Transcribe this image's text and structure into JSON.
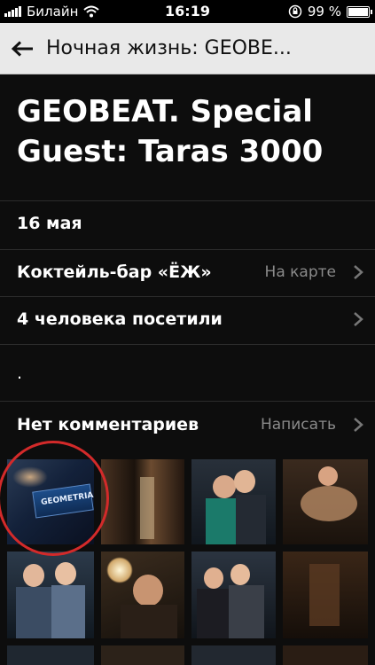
{
  "status_bar": {
    "carrier": "Билайн",
    "time": "16:19",
    "battery": "99 %",
    "battery_level": 0.99
  },
  "header": {
    "back_icon": "back-arrow-icon",
    "title": "Ночная жизнь: GEOBE..."
  },
  "event": {
    "title": "GEOBEAT. Special Guest: Taras 3000",
    "date": "16 мая",
    "venue": "Коктейль-бар «ЁЖ»",
    "venue_action": "На карте",
    "visitors": "4 человека посетили",
    "description": ".",
    "comments": "Нет комментариев",
    "comments_action": "Написать"
  },
  "photos": {
    "first_photo_text": "GEOMETRIA"
  },
  "colors": {
    "background": "#0d0d0d",
    "header_bg": "#e9e9e9",
    "secondary_text": "#8a8a8a",
    "highlight_circle": "#d32a2a"
  }
}
